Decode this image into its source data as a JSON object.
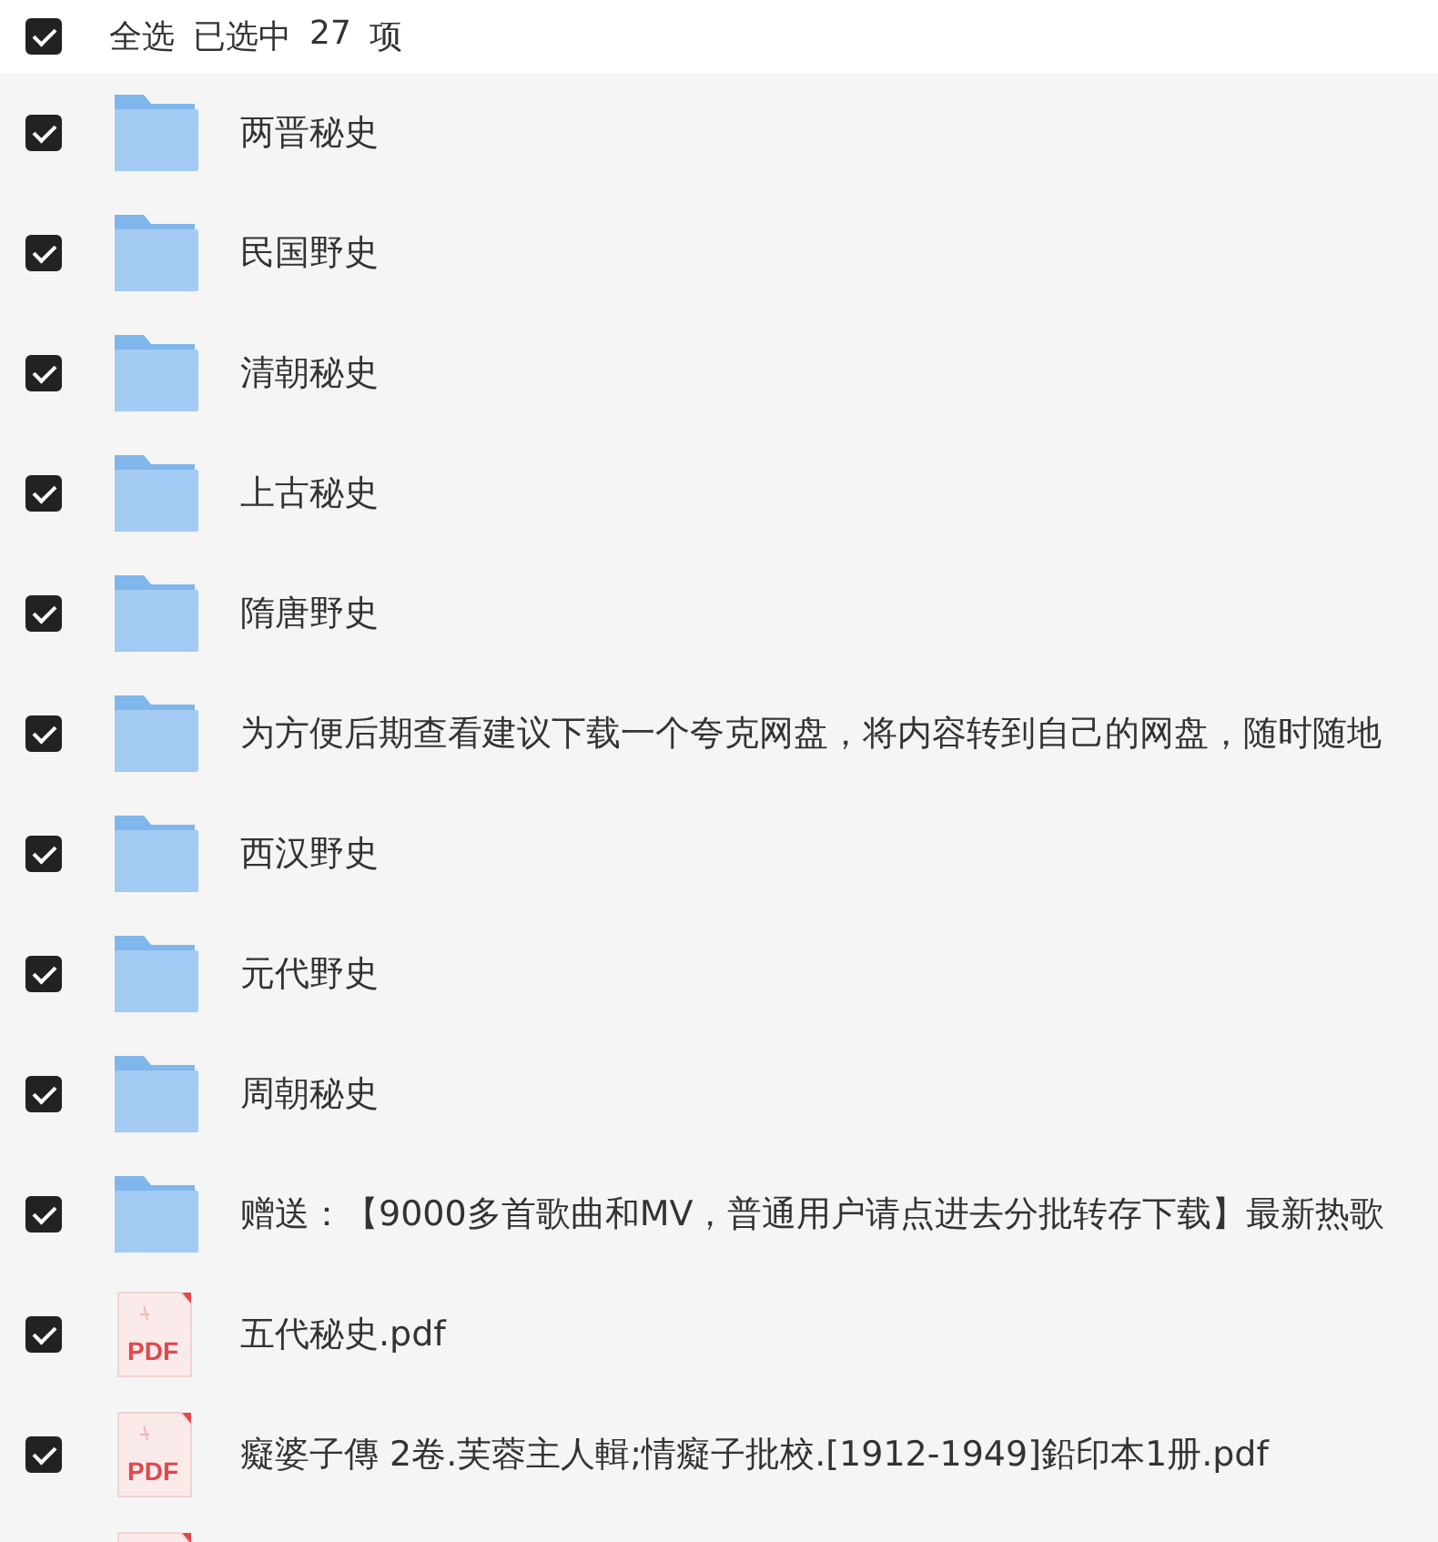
{
  "header": {
    "select_all": {
      "label": "全选",
      "checked": true
    },
    "selected_label": "已选中",
    "count": "27",
    "unit": "项"
  },
  "items": [
    {
      "kind": "folder",
      "name": "两晋秘史",
      "checked": true
    },
    {
      "kind": "folder",
      "name": "民国野史",
      "checked": true
    },
    {
      "kind": "folder",
      "name": "清朝秘史",
      "checked": true
    },
    {
      "kind": "folder",
      "name": "上古秘史",
      "checked": true
    },
    {
      "kind": "folder",
      "name": "隋唐野史",
      "checked": true
    },
    {
      "kind": "folder",
      "name": "为方便后期查看建议下载一个夸克网盘，将内容转到自己的网盘，随时随地",
      "checked": true
    },
    {
      "kind": "folder",
      "name": "西汉野史",
      "checked": true
    },
    {
      "kind": "folder",
      "name": "元代野史",
      "checked": true
    },
    {
      "kind": "folder",
      "name": "周朝秘史",
      "checked": true
    },
    {
      "kind": "folder",
      "name": "赠送：【9000多首歌曲和MV，普通用户请点进去分批转存下载】最新热歌",
      "checked": true
    },
    {
      "kind": "pdf",
      "name": "五代秘史.pdf",
      "icon_label": "PDF",
      "checked": true
    },
    {
      "kind": "pdf",
      "name": "癡婆子傳 2卷.芙蓉主人輯;情癡子批校.[1912-1949]鉛印本1册.pdf",
      "icon_label": "PDF",
      "checked": true
    },
    {
      "kind": "pdf"
    }
  ]
}
